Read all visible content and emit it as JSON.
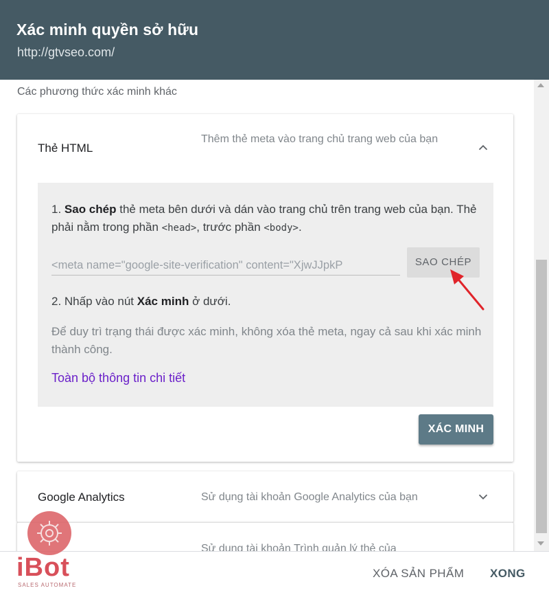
{
  "dialog": {
    "title": "Xác minh quyền sở hữu",
    "url": "http://gtvseo.com/"
  },
  "section_label": "Các phương thức xác minh khác",
  "html_method": {
    "title": "Thẻ HTML",
    "description": "Thêm thẻ meta vào trang chủ trang web của bạn",
    "step1_bold": "Sao chép",
    "step1_text_a": " thẻ meta bên dưới và dán vào trang chủ trên trang web của bạn. Thẻ phải nằm trong phần ",
    "step1_code_head": "<head>",
    "step1_text_b": ", trước phần ",
    "step1_code_body": "<body>",
    "step1_text_c": ".",
    "meta_tag_value": "<meta name=\"google-site-verification\" content=\"XjwJJpkP",
    "copy_label": "SAO CHÉP",
    "step2_text_a": "2. Nhấp vào nút ",
    "step2_bold": "Xác minh",
    "step2_text_b": " ở dưới.",
    "note": "Để duy trì trạng thái được xác minh, không xóa thẻ meta, ngay cả sau khi xác minh thành công.",
    "details_link": "Toàn bộ thông tin chi tiết",
    "verify_label": "XÁC MINH"
  },
  "ga_method": {
    "title": "Google Analytics",
    "description": "Sử dụng tài khoản Google Analytics của bạn"
  },
  "gtm_method": {
    "description": "Sử dụng tài khoản Trình quản lý thẻ của"
  },
  "footer": {
    "remove_label": "XÓA SẢN PHẨM",
    "done_label": "XONG"
  },
  "watermark": {
    "brand": "iBot",
    "tagline": "SALES AUTOMATE"
  },
  "colors": {
    "header_bg": "#455a64",
    "verify_bg": "#5d7a87",
    "link": "#6a1fc9",
    "arrow": "#e0242a"
  },
  "icons": {
    "expand_less": "chevron-up-icon",
    "expand_more": "chevron-down-icon"
  }
}
